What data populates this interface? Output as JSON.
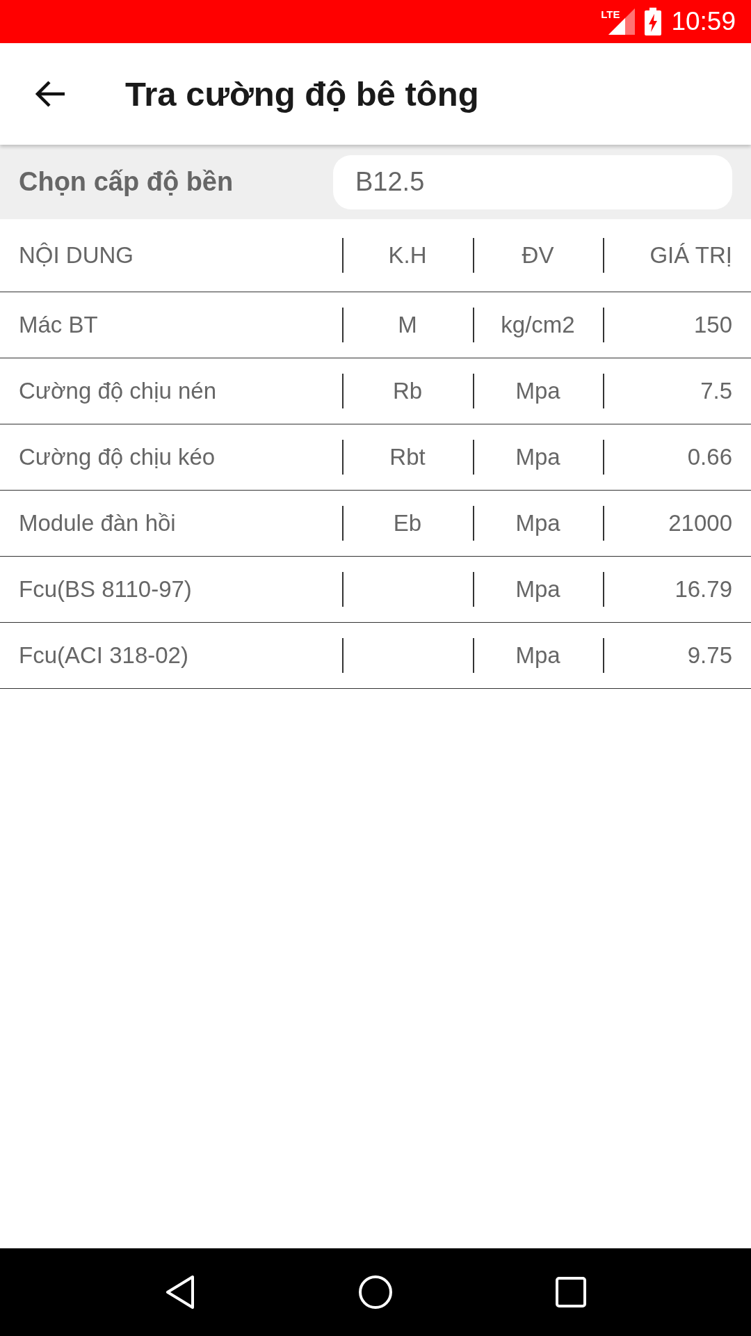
{
  "status_bar": {
    "network": "LTE",
    "time": "10:59"
  },
  "app_bar": {
    "title": "Tra cường độ bê tông"
  },
  "selector": {
    "label": "Chọn cấp độ bền",
    "value": "B12.5"
  },
  "table": {
    "columns": [
      "NỘI DUNG",
      "K.H",
      "ĐV",
      "GIÁ TRỊ"
    ],
    "rows": [
      [
        "Mác BT",
        "M",
        "kg/cm2",
        "150"
      ],
      [
        "Cường độ chịu nén",
        "Rb",
        "Mpa",
        "7.5"
      ],
      [
        "Cường độ chịu kéo",
        "Rbt",
        "Mpa",
        "0.66"
      ],
      [
        "Module đàn hồi",
        "Eb",
        "Mpa",
        "21000"
      ],
      [
        "Fcu(BS 8110-97)",
        "",
        "Mpa",
        "16.79"
      ],
      [
        "Fcu(ACI 318-02)",
        "",
        "Mpa",
        "9.75"
      ]
    ]
  }
}
